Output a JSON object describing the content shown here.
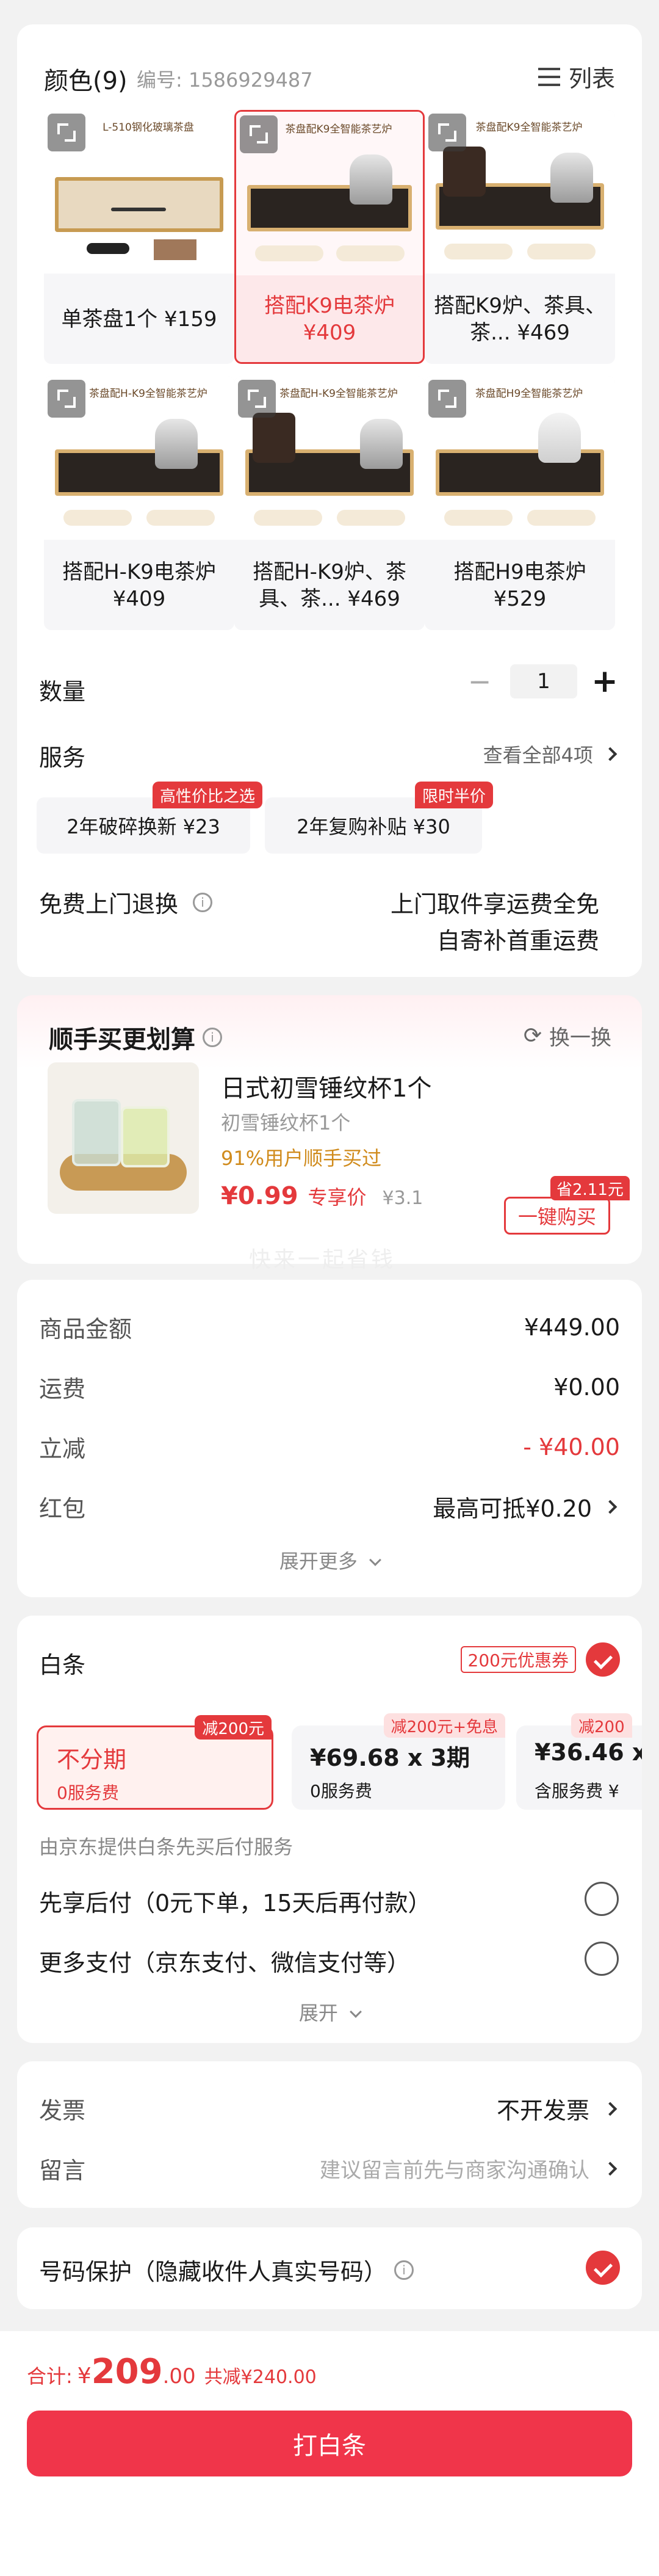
{
  "variants": {
    "title": "颜色(9)",
    "code_label": "编号: 1586929487",
    "list_label": "列表",
    "items": [
      {
        "label": "单茶盘1个 ¥159",
        "banner": "L-510钢化玻璃茶盘"
      },
      {
        "label": "搭配K9电茶炉\n¥409",
        "banner": "茶盘配K9全智能茶艺炉"
      },
      {
        "label": "搭配K9炉、茶具、茶... ¥469",
        "banner": "茶盘配K9全智能茶艺炉"
      },
      {
        "label": "搭配H-K9电茶炉\n¥409",
        "banner": "茶盘配H-K9全智能茶艺炉"
      },
      {
        "label": "搭配H-K9炉、茶具、茶... ¥469",
        "banner": "茶盘配H-K9全智能茶艺炉"
      },
      {
        "label": "搭配H9电茶炉\n¥529",
        "banner": "茶盘配H9全智能茶艺炉"
      }
    ]
  },
  "quantity": {
    "label": "数量",
    "value": "1",
    "minus": "−",
    "plus": "+"
  },
  "service": {
    "label": "服务",
    "view_all": "查看全部4项",
    "options": [
      {
        "text": "2年破碎换新 ¥23",
        "tag": "高性价比之选"
      },
      {
        "text": "2年复购补贴 ¥30",
        "tag": "限时半价"
      }
    ]
  },
  "return_service": {
    "label": "免费上门退换",
    "line1": "上门取件享运费全免",
    "line2": "自寄补首重运费"
  },
  "addon": {
    "title": "顺手买更划算",
    "refresh": "换一换",
    "name": "日式初雪锤纹杯1个",
    "sub": "初雪锤纹杯1个",
    "stat": "91%用户顺手买过",
    "price": "¥0.99",
    "price_label": "专享价",
    "orig_price": "¥3.1",
    "save_tag": "省2.11元",
    "buy_button": "一键购买",
    "watermark": "快来一起省钱"
  },
  "summary": {
    "rows": [
      {
        "label": "商品金额",
        "value": "¥449.00"
      },
      {
        "label": "运费",
        "value": "¥0.00"
      },
      {
        "label": "立减",
        "value": "- ¥40.00"
      },
      {
        "label": "红包",
        "value": "最高可抵¥0.20"
      }
    ],
    "expand": "展开更多"
  },
  "baitiao": {
    "label": "白条",
    "coupon": "200元优惠券",
    "plans": [
      {
        "big": "不分期",
        "small": "0服务费",
        "tag": "减200元"
      },
      {
        "big": "¥69.68 x 3期",
        "small": "0服务费",
        "tag": "减200元+免息"
      },
      {
        "big": "¥36.46 x",
        "small": "含服务费 ¥",
        "tag": "减200"
      }
    ],
    "note": "由京东提供白条先买后付服务",
    "options": [
      {
        "label": "先享后付（0元下单，15天后再付款）"
      },
      {
        "label": "更多支付（京东支付、微信支付等）"
      }
    ],
    "expand": "展开"
  },
  "invoice": {
    "label": "发票",
    "value": "不开发票"
  },
  "message": {
    "label": "留言",
    "placeholder": "建议留言前先与商家沟通确认"
  },
  "privacy": {
    "label": "号码保护（隐藏收件人真实号码）"
  },
  "footer": {
    "total_label": "合计:",
    "total_currency": "¥",
    "total_int": "209",
    "total_dec": ".00",
    "saved": "共减¥240.00",
    "pay_button": "打白条"
  },
  "colors": {
    "accent": "#e4393c",
    "background": "#f2f2f2"
  }
}
